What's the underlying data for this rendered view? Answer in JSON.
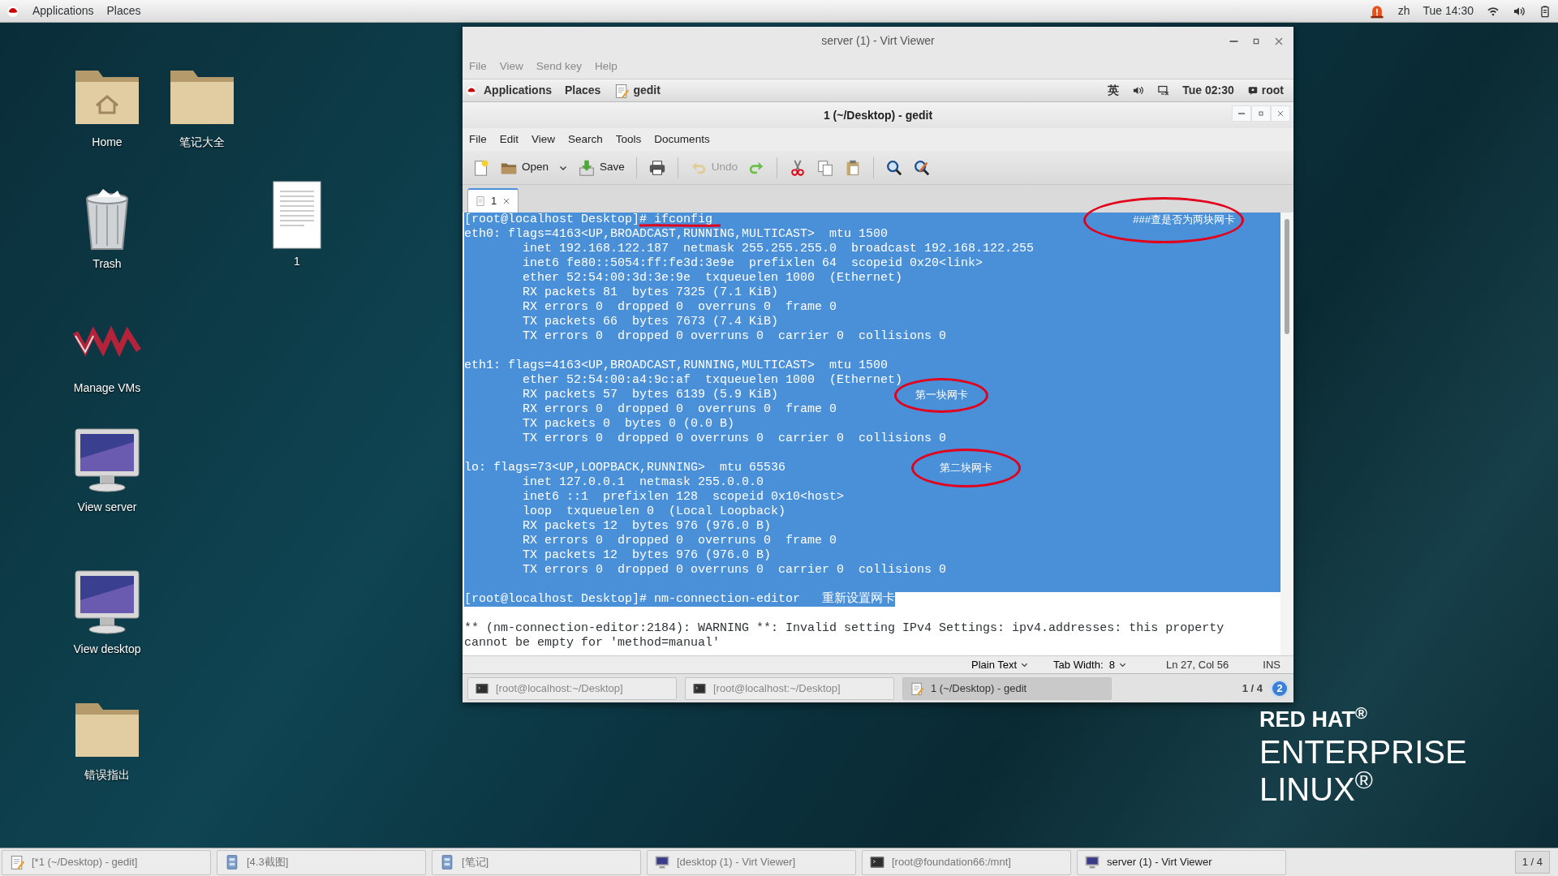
{
  "top_bar": {
    "menus": [
      "Applications",
      "Places"
    ],
    "input_method": "zh",
    "clock": "Tue 14:30"
  },
  "desktop_icons": [
    {
      "label": "Home",
      "kind": "home"
    },
    {
      "label": "笔记大全",
      "kind": "folder"
    },
    {
      "label": "Trash",
      "kind": "trash"
    },
    {
      "label": "1",
      "kind": "document"
    },
    {
      "label": "Manage VMs",
      "kind": "vm"
    },
    {
      "label": "View server",
      "kind": "monitor"
    },
    {
      "label": "View desktop",
      "kind": "monitor"
    },
    {
      "label": "错误指出",
      "kind": "folder"
    }
  ],
  "window": {
    "title": "server (1) - Virt Viewer",
    "menu": [
      "File",
      "View",
      "Send key",
      "Help"
    ],
    "guest_top_bar": {
      "menus": [
        "Applications",
        "Places"
      ],
      "app": "gedit",
      "input_method": "英",
      "clock": "Tue 02:30",
      "user": "root"
    },
    "editor": {
      "title": "1 (~/Desktop) - gedit",
      "menu": [
        "File",
        "Edit",
        "View",
        "Search",
        "Tools",
        "Documents"
      ],
      "toolbar": [
        {
          "kind": "new",
          "disabled": false
        },
        {
          "kind": "open",
          "label": "Open",
          "disabled": false
        },
        {
          "kind": "save",
          "label": "Save",
          "disabled": false
        },
        {
          "kind": "print",
          "disabled": false
        },
        {
          "kind": "undo",
          "label": "Undo",
          "disabled": true
        },
        {
          "kind": "redo",
          "disabled": false
        },
        {
          "kind": "cut",
          "disabled": false
        },
        {
          "kind": "copy",
          "disabled": false
        },
        {
          "kind": "paste",
          "disabled": false
        },
        {
          "kind": "find",
          "disabled": false
        },
        {
          "kind": "replace",
          "disabled": false
        }
      ],
      "tabs": [
        {
          "label": "1",
          "selected": true
        }
      ],
      "lines": [
        {
          "text": "[root@localhost Desktop]# ifconfig",
          "selected": true,
          "note": "###查是否为两块网卡"
        },
        {
          "text": "eth0: flags=4163<UP,BROADCAST,RUNNING,MULTICAST>  mtu 1500",
          "selected": true
        },
        {
          "text": "        inet 192.168.122.187  netmask 255.255.255.0  broadcast 192.168.122.255",
          "selected": true
        },
        {
          "text": "        inet6 fe80::5054:ff:fe3d:3e9e  prefixlen 64  scopeid 0x20<link>",
          "selected": true
        },
        {
          "text": "        ether 52:54:00:3d:3e:9e  txqueuelen 1000  (Ethernet)",
          "selected": true
        },
        {
          "text": "        RX packets 81  bytes 7325 (7.1 KiB)",
          "selected": true
        },
        {
          "text": "        RX errors 0  dropped 0  overruns 0  frame 0",
          "selected": true
        },
        {
          "text": "        TX packets 66  bytes 7673 (7.4 KiB)",
          "selected": true
        },
        {
          "text": "        TX errors 0  dropped 0 overruns 0  carrier 0  collisions 0",
          "selected": true
        },
        {
          "selected": true
        },
        {
          "text": "eth1: flags=4163<UP,BROADCAST,RUNNING,MULTICAST>  mtu 1500",
          "selected": true
        },
        {
          "text": "        ether 52:54:00:a4:9c:af  txqueuelen 1000  (Ethernet)",
          "selected": true
        },
        {
          "text": "        RX packets 57  bytes 6139 (5.9 KiB)",
          "selected": true,
          "note": "第一块网卡"
        },
        {
          "text": "        RX errors 0  dropped 0  overruns 0  frame 0",
          "selected": true
        },
        {
          "text": "        TX packets 0  bytes 0 (0.0 B)",
          "selected": true
        },
        {
          "text": "        TX errors 0  dropped 0 overruns 0  carrier 0  collisions 0",
          "selected": true
        },
        {
          "selected": true
        },
        {
          "text": "lo: flags=73<UP,LOOPBACK,RUNNING>  mtu 65536",
          "selected": true,
          "note": "第二块网卡"
        },
        {
          "text": "        inet 127.0.0.1  netmask 255.0.0.0",
          "selected": true
        },
        {
          "text": "        inet6 ::1  prefixlen 128  scopeid 0x10<host>",
          "selected": true
        },
        {
          "text": "        loop  txqueuelen 0  (Local Loopback)",
          "selected": true
        },
        {
          "text": "        RX packets 12  bytes 976 (976.0 B)",
          "selected": true
        },
        {
          "text": "        RX errors 0  dropped 0  overruns 0  frame 0",
          "selected": true
        },
        {
          "text": "        TX packets 12  bytes 976 (976.0 B)",
          "selected": true
        },
        {
          "text": "        TX errors 0  dropped 0 overruns 0  carrier 0  collisions 0",
          "selected": true
        },
        {
          "selected": true
        },
        {
          "text": "[root@localhost Desktop]# nm-connection-editor   重新设置网卡",
          "selected": true
        },
        {
          "selected": false
        },
        {
          "text": "** (nm-connection-editor:2184): WARNING **: Invalid setting IPv4 Settings: ipv4.addresses: this property",
          "selected": false
        },
        {
          "text": "cannot be empty for 'method=manual'",
          "selected": false
        }
      ],
      "status_bar": {
        "language": "Plain Text",
        "tab_width": "Tab Width:  8",
        "position": "Ln 27, Col 56",
        "mode": "INS"
      }
    },
    "guest_taskbar": [
      {
        "label": "[root@localhost:~/Desktop]",
        "kind": "terminal",
        "selected": false
      },
      {
        "label": "[root@localhost:~/Desktop]",
        "kind": "terminal",
        "selected": false
      },
      {
        "label": "1 (~/Desktop) - gedit",
        "kind": "editor",
        "selected": true
      }
    ],
    "guest_pager": "1 / 4",
    "guest_notifications": "2"
  },
  "taskbar": [
    {
      "label": "[*1 (~/Desktop) - gedit]",
      "kind": "editor",
      "selected": false
    },
    {
      "label": "[4.3截图]",
      "kind": "cabinet",
      "selected": false
    },
    {
      "label": "[笔记]",
      "kind": "cabinet",
      "selected": false
    },
    {
      "label": "[desktop (1) - Virt Viewer]",
      "kind": "monitor",
      "selected": false
    },
    {
      "label": "[root@foundation66:/mnt]",
      "kind": "terminal",
      "selected": false
    },
    {
      "label": "server (1) - Virt Viewer",
      "kind": "monitor",
      "selected": true
    }
  ],
  "pager": "1 / 4",
  "brand": [
    "RED HAT$^{®}$",
    "ENTERPRISE",
    "LINUX$^{®}$"
  ]
}
